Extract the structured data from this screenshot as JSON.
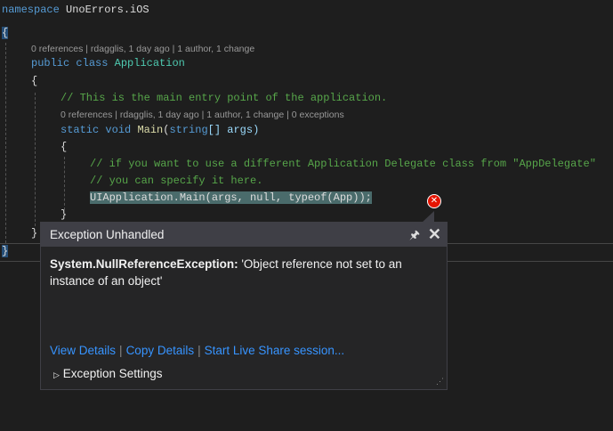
{
  "code": {
    "ns_kw": "namespace",
    "ns_name": "UnoErrors.iOS",
    "lens1": "0 references | rdagglis, 1 day ago | 1 author, 1 change",
    "public_kw": "public",
    "class_kw": "class",
    "class_name": "Application",
    "comment1": "// This is the main entry point of the application.",
    "lens2": "0 references | rdagglis, 1 day ago | 1 author, 1 change | 0 exceptions",
    "static_kw": "static",
    "void_kw": "void",
    "method": "Main",
    "string_kw": "string",
    "param": "[] args)",
    "comment2": "// if you want to use a different Application Delegate class from \"AppDelegate\"",
    "comment3": "// you can specify it here.",
    "call": "UIApplication.Main(args, null, typeof(App));",
    "open_brace": "{",
    "close_brace": "}"
  },
  "popup": {
    "title": "Exception Unhandled",
    "exception_type": "System.NullReferenceException:",
    "message": " 'Object reference not set to an instance of an object'",
    "links": [
      "View Details",
      "Copy Details",
      "Start Live Share session..."
    ],
    "settings": "Exception Settings"
  }
}
